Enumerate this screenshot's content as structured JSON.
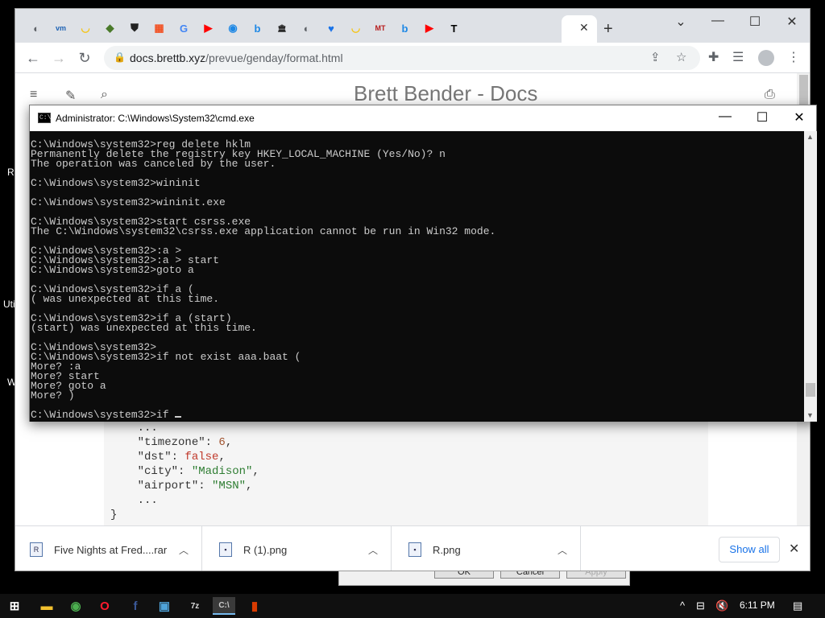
{
  "desktop": {
    "labels": [
      "R",
      "Uti",
      "W"
    ]
  },
  "bg_dialog": {
    "ok_label": "OK",
    "cancel_label": "Cancel",
    "apply_label": "Apply"
  },
  "chrome": {
    "tabs": [
      {
        "icon": "globe-icon",
        "glyph": "◐",
        "color": "#5f6368"
      },
      {
        "icon": "vmware-icon",
        "glyph": "vm",
        "color": "#1d62b4"
      },
      {
        "icon": "honey-icon",
        "glyph": "◡",
        "color": "#f5c518"
      },
      {
        "icon": "shield-green-icon",
        "glyph": "◆",
        "color": "#4a7a2a"
      },
      {
        "icon": "shield-icon",
        "glyph": "⛊",
        "color": "#222222"
      },
      {
        "icon": "microsoft-icon",
        "glyph": "▦",
        "color": "#f25022"
      },
      {
        "icon": "google-icon",
        "glyph": "G",
        "color": "#4285f4"
      },
      {
        "icon": "youtube-icon",
        "glyph": "▶",
        "color": "#ff0000"
      },
      {
        "icon": "tiktok-icon",
        "glyph": "◉",
        "color": "#1e88e5"
      },
      {
        "icon": "bing-icon",
        "glyph": "b",
        "color": "#1e88e5"
      },
      {
        "icon": "museum-icon",
        "glyph": "🏛",
        "color": "#222222"
      },
      {
        "icon": "globe-icon",
        "glyph": "◐",
        "color": "#5f6368"
      },
      {
        "icon": "heart-icon",
        "glyph": "♥",
        "color": "#1a73e8"
      },
      {
        "icon": "honey-icon",
        "glyph": "◡",
        "color": "#f5c518"
      },
      {
        "icon": "mt-icon",
        "glyph": "MT",
        "color": "#b71c1c"
      },
      {
        "icon": "bing-icon",
        "glyph": "b",
        "color": "#1e88e5"
      },
      {
        "icon": "youtube-icon",
        "glyph": "▶",
        "color": "#ff0000"
      },
      {
        "icon": "t-icon",
        "glyph": "T",
        "color": "#000000"
      }
    ],
    "active_tab_close": "✕",
    "new_tab": "+",
    "url_host": "docs.brettb.xyz",
    "url_path": "/prevue/genday/format.html"
  },
  "site": {
    "title": "Brett Bender - Docs"
  },
  "code_lines": [
    {
      "parts": [
        {
          "t": "    ...",
          "c": ""
        }
      ]
    },
    {
      "parts": [
        {
          "t": "    \"timezone\": ",
          "c": ""
        },
        {
          "t": "6",
          "c": "num"
        },
        {
          "t": ",",
          "c": ""
        }
      ]
    },
    {
      "parts": [
        {
          "t": "    \"dst\": ",
          "c": ""
        },
        {
          "t": "false",
          "c": "bool"
        },
        {
          "t": ",",
          "c": ""
        }
      ]
    },
    {
      "parts": [
        {
          "t": "    \"city\": ",
          "c": ""
        },
        {
          "t": "\"Madison\"",
          "c": "str"
        },
        {
          "t": ",",
          "c": ""
        }
      ]
    },
    {
      "parts": [
        {
          "t": "    \"airport\": ",
          "c": ""
        },
        {
          "t": "\"MSN\"",
          "c": "str"
        },
        {
          "t": ",",
          "c": ""
        }
      ]
    },
    {
      "parts": [
        {
          "t": "    ...",
          "c": ""
        }
      ]
    },
    {
      "parts": [
        {
          "t": "}",
          "c": ""
        }
      ]
    }
  ],
  "downloads": [
    {
      "name": "Five Nights at Fred....rar"
    },
    {
      "name": "R (1).png"
    },
    {
      "name": "R.png"
    }
  ],
  "show_all_label": "Show all",
  "cmd": {
    "title": "Administrator: C:\\Windows\\System32\\cmd.exe",
    "lines": [
      "C:\\Windows\\system32>reg delete hklm",
      "Permanently delete the registry key HKEY_LOCAL_MACHINE (Yes/No)? n",
      "The operation was canceled by the user.",
      "",
      "C:\\Windows\\system32>wininit",
      "",
      "C:\\Windows\\system32>wininit.exe",
      "",
      "C:\\Windows\\system32>start csrss.exe",
      "The C:\\Windows\\system32\\csrss.exe application cannot be run in Win32 mode.",
      "",
      "C:\\Windows\\system32>:a >",
      "C:\\Windows\\system32>:a > start",
      "C:\\Windows\\system32>goto a",
      "",
      "C:\\Windows\\system32>if a (",
      "( was unexpected at this time.",
      "",
      "C:\\Windows\\system32>if a (start)",
      "(start) was unexpected at this time.",
      "",
      "C:\\Windows\\system32>",
      "C:\\Windows\\system32>if not exist aaa.baat (",
      "More? :a",
      "More? start",
      "More? goto a",
      "More? )",
      ""
    ],
    "prompt_line": "C:\\Windows\\system32>if "
  },
  "taskbar": {
    "apps": [
      {
        "icon": "windows-start-icon",
        "glyph": "⊞",
        "color": "#ffffff"
      },
      {
        "icon": "file-explorer-icon",
        "glyph": "▬",
        "color": "#f2c12e"
      },
      {
        "icon": "chrome-icon",
        "glyph": "◉",
        "color": "#4caf50"
      },
      {
        "icon": "opera-icon",
        "glyph": "O",
        "color": "#ff1b2d"
      },
      {
        "icon": "facebook-icon",
        "glyph": "f",
        "color": "#3b5998"
      },
      {
        "icon": "control-panel-icon",
        "glyph": "▣",
        "color": "#4fa3d9"
      },
      {
        "icon": "7zip-icon",
        "glyph": "7z",
        "color": "#dddddd"
      },
      {
        "icon": "cmd-icon",
        "glyph": "C:\\",
        "color": "#cccccc"
      },
      {
        "icon": "office-icon",
        "glyph": "▮",
        "color": "#d83b01"
      }
    ],
    "clock": "6:11 PM"
  }
}
